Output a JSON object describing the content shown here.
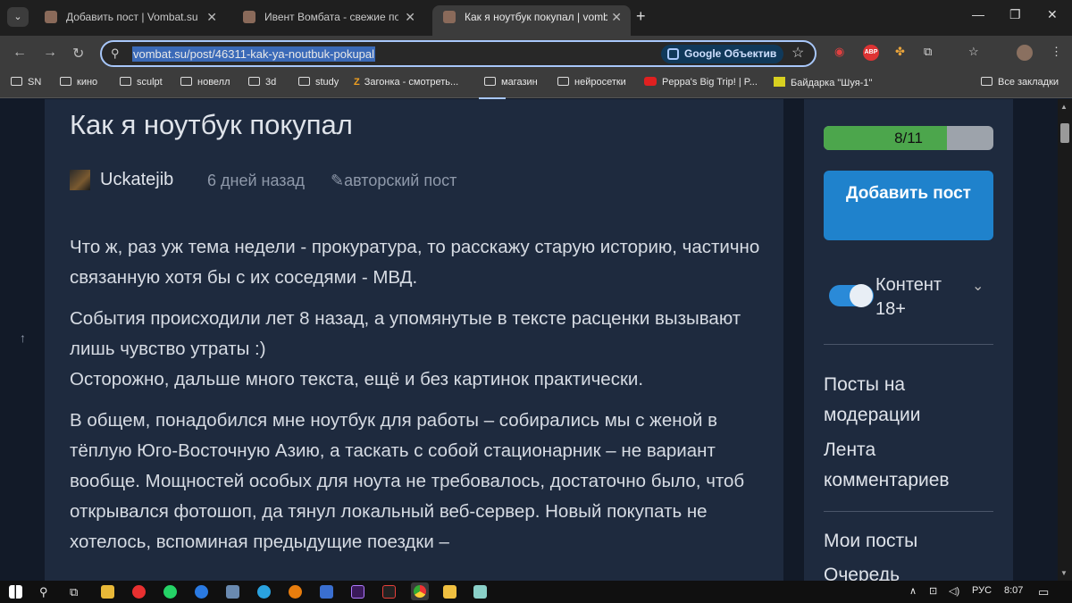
{
  "browser": {
    "tabs": [
      {
        "title": "Добавить пост | Vombat.su"
      },
      {
        "title": "Ивент Вомбата - свежие посты"
      },
      {
        "title": "Как я ноутбук покупал | vomb"
      }
    ],
    "url": "vombat.su/post/46311-kak-ya-noutbuk-pokupal",
    "lens_label": "Google Объектив",
    "bookmarks": [
      "SN",
      "кино",
      "sculpt",
      "новелл",
      "3d",
      "study",
      "Загонка - смотреть...",
      "магазин",
      "нейросетки",
      "Peppa's Big Trip! | P...",
      "Байдарка \"Шуя-1\"",
      "Все закладки"
    ],
    "extension_abp": "ABP"
  },
  "post": {
    "title": "Как я ноутбук покупал",
    "author": "Uckatejib",
    "time": "6 дней назад",
    "badge": "авторский пост",
    "paragraphs": [
      "Что ж, раз уж тема недели - прокуратура, то расскажу старую историю, частично связанную хотя бы с их соседями - МВД.",
      "События происходили лет 8 назад, а упомянутые в тексте расценки вызывают лишь чувство утраты :)",
      "Осторожно, дальше много текста, ещё и без картинок практически.",
      "В общем, понадобился мне ноутбук для работы – собирались мы с женой в тёплую Юго-Восточную Азию, а таскать с собой стационарник – не вариант вообще. Мощностей особых для ноута не требовалось, достаточно было, чтоб открывался фотошоп, да тянул локальный веб-сервер. Новый покупать не хотелось, вспоминая предыдущие поездки –"
    ]
  },
  "sidebar": {
    "progress_label": "8/11",
    "progress_value": 0.727,
    "add_post_label": "Добавить пост",
    "content_toggle_label": "Контент 18+",
    "links": [
      "Посты на модерации",
      "Лента комментариев",
      "Мои посты",
      "Очередь"
    ]
  },
  "taskbar": {
    "lang": "РУС",
    "clock": "8:07"
  },
  "colors": {
    "page_bg": "#121a28",
    "card_bg": "#1e2a3e",
    "accent": "#1f82cc",
    "progress_fill": "#4ca64c"
  }
}
